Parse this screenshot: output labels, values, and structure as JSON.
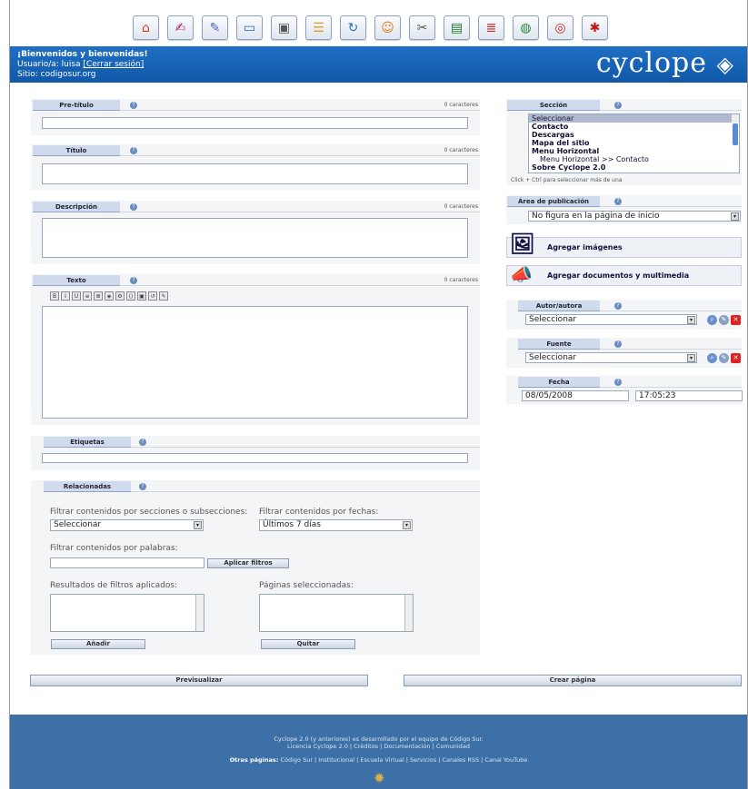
{
  "toolbar": [
    "home-icon",
    "edit-icon",
    "pen-icon",
    "monitor-icon",
    "image-icon",
    "layout-icon",
    "refresh-icon",
    "users-icon",
    "tools-icon",
    "chalkboard-icon",
    "books-icon",
    "network-icon",
    "lifebuoy-icon",
    "bug-icon"
  ],
  "header": {
    "welcome": "¡Bienvenidos y bienvenidas!",
    "user_prefix": "Usuario/a: luisa ",
    "logout": "[Cerrar sesión]",
    "site": "Sitio: codigosur.org",
    "logo": "cyclope"
  },
  "pretitulo": {
    "label": "Pre-título",
    "count": "0 caracteres"
  },
  "titulo": {
    "label": "Título",
    "count": "0 caracteres"
  },
  "descripcion": {
    "label": "Descripción",
    "count": "0 caracteres"
  },
  "texto": {
    "label": "Texto",
    "count": "0 caracteres",
    "tools": [
      "B",
      "I",
      "U",
      "≡",
      "≣",
      "◈",
      "⚙",
      "⟨⟩",
      "▣",
      "↺",
      "✎"
    ]
  },
  "etiquetas": {
    "label": "Etiquetas"
  },
  "relacionadas": {
    "label": "Relacionadas",
    "filter_sections_label": "Filtrar contenidos por secciones o subsecciones:",
    "filter_sections_value": "Seleccionar",
    "filter_dates_label": "Filtrar contenidos por fechas:",
    "filter_dates_value": "Últimos 7 días",
    "filter_words_label": "Filtrar contenidos por palabras:",
    "apply": "Aplicar filtros",
    "results_label": "Resultados de filtros aplicados:",
    "selected_label": "Páginas seleccionadas:",
    "add": "Añadir",
    "remove": "Quitar"
  },
  "seccion": {
    "label": "Sección",
    "items": [
      {
        "text": "Seleccionar",
        "kind": "selected"
      },
      {
        "text": "Contacto",
        "kind": "top"
      },
      {
        "text": "Descargas",
        "kind": "top"
      },
      {
        "text": "Mapa del sitio",
        "kind": "top"
      },
      {
        "text": "Menu Horizontal",
        "kind": "top"
      },
      {
        "text": "Menu Horizontal >> Contacto",
        "kind": "sub"
      },
      {
        "text": "Sobre Cyclope 2.0",
        "kind": "top"
      }
    ],
    "hint": "Click + Ctrl para seleccionar más de una"
  },
  "area": {
    "label": "Área de publicación",
    "value": "No figura en la página de inicio"
  },
  "agregar_imagenes": "Agregar imágenes",
  "agregar_docs": "Agregar documentos y multimedia",
  "autor": {
    "label": "Autor/autora",
    "value": "Seleccionar"
  },
  "fuente": {
    "label": "Fuente",
    "value": "Seleccionar"
  },
  "fecha": {
    "label": "Fecha",
    "date": "08/05/2008",
    "time": "17:05:23"
  },
  "actions": {
    "preview": "Previsualizar",
    "create": "Crear página"
  },
  "footer": {
    "line1": "Cyclope 2.0 (y anteriores) es desarrollado por el equipo de Código Sur.",
    "line2": "Licencia Cyclope 2.0 | Créditos | Documentación | Comunidad",
    "line3_label": "Otras páginas:",
    "line3": "Código Sur | Institucional | Escuela Virtual | Servicios | Canales RSS | Canal YouTube"
  }
}
